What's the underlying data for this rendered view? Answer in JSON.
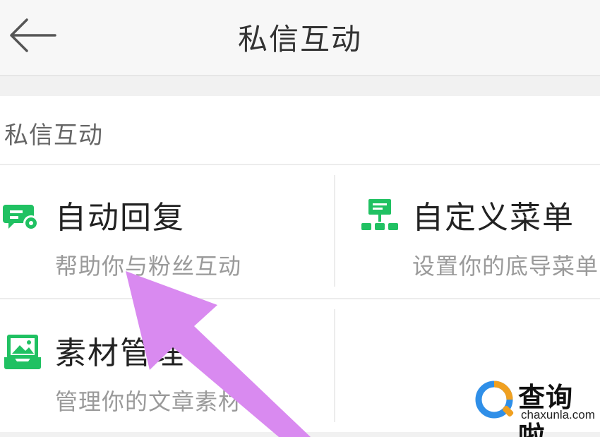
{
  "header": {
    "title": "私信互动"
  },
  "section": {
    "title": "私信互动"
  },
  "tiles": [
    {
      "name": "自动回复",
      "desc": "帮助你与粉丝互动",
      "icon": "chat-gear-icon"
    },
    {
      "name": "自定义菜单",
      "desc": "设置你的底导菜单",
      "icon": "menu-tree-icon"
    },
    {
      "name": "素材管理",
      "desc": "管理你的文章素材",
      "icon": "image-tray-icon"
    }
  ],
  "watermark": {
    "text": "查询啦",
    "domain": "chaxunla.com"
  },
  "colors": {
    "accent": "#20c162",
    "arrow": "#d98af0",
    "text": "#222222",
    "subtext": "#9a9a9a"
  }
}
